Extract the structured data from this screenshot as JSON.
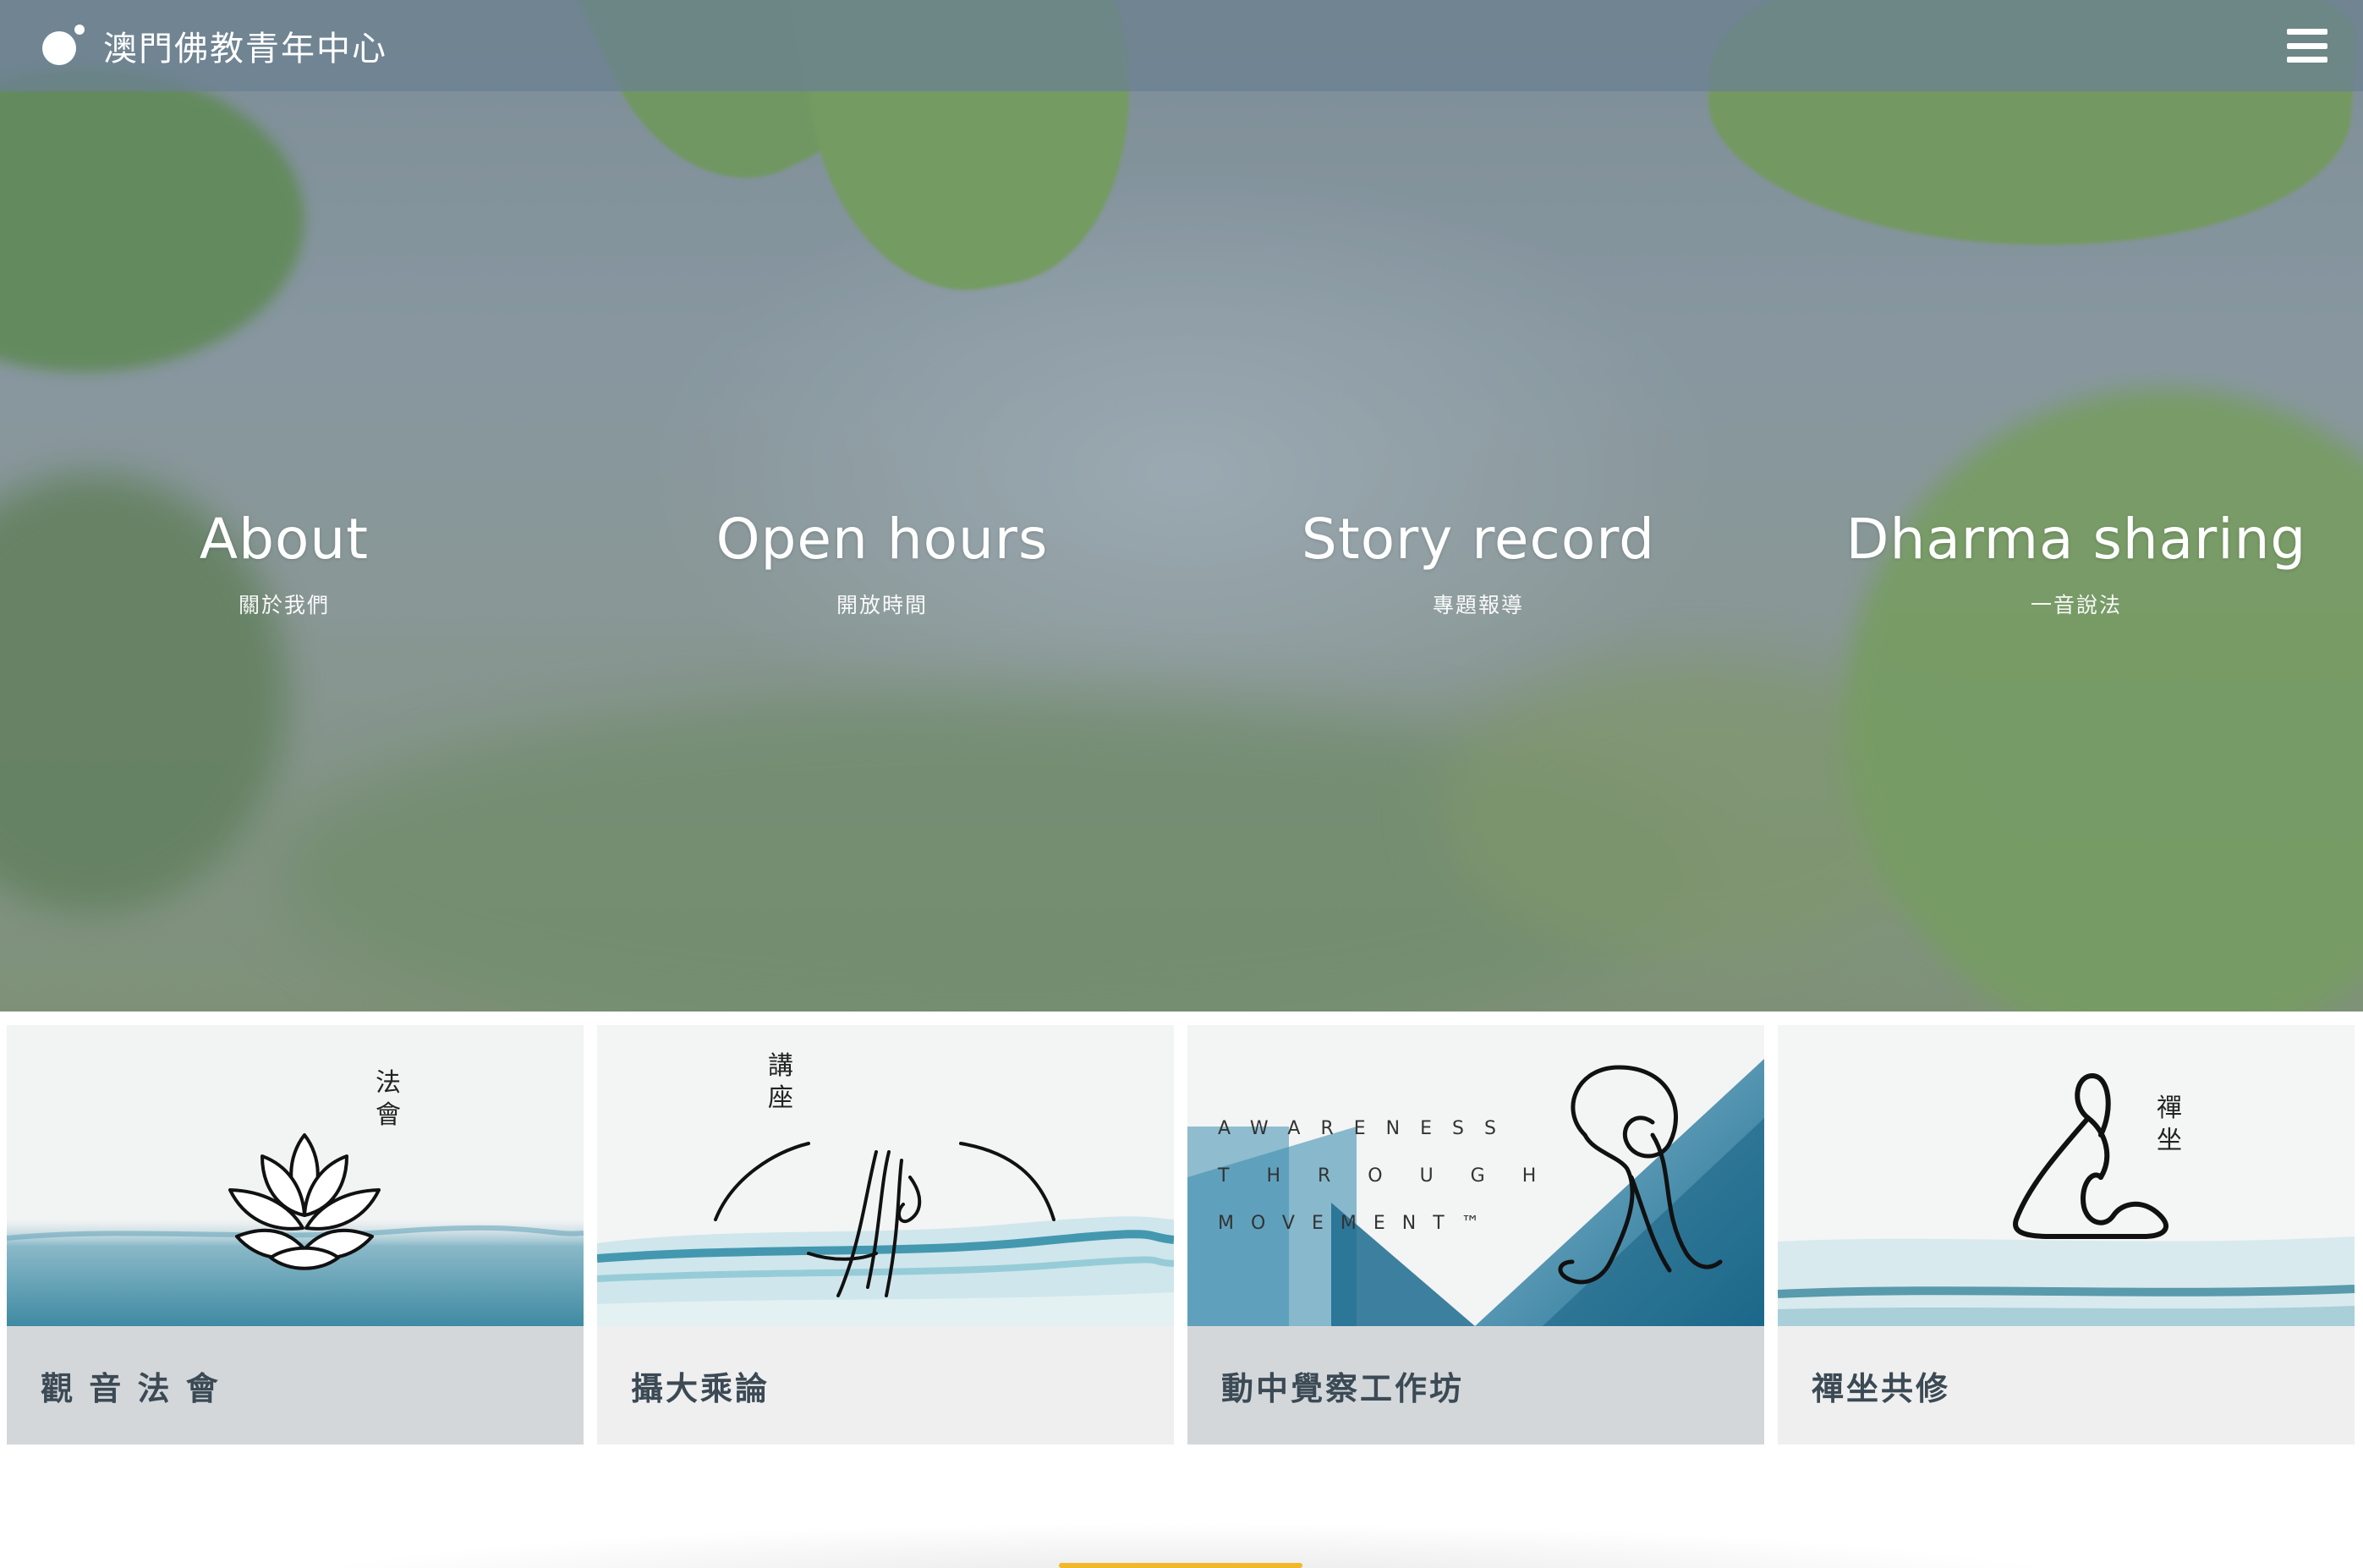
{
  "header": {
    "title": "澳門佛教青年中心",
    "logo_icon": "circle-dot-logo-icon",
    "menu_icon": "hamburger-icon"
  },
  "hero_nav": [
    {
      "en": "About",
      "zh": "關於我們"
    },
    {
      "en": "Open hours",
      "zh": "開放時間"
    },
    {
      "en": "Story record",
      "zh": "專題報導"
    },
    {
      "en": "Dharma sharing",
      "zh": "一音說法"
    }
  ],
  "cards": [
    {
      "label": "觀 音 法 會",
      "art_text": [
        "法",
        "會"
      ],
      "art_icon": "lotus-icon"
    },
    {
      "label": "攝大乘論",
      "art_text": [
        "講",
        "座"
      ],
      "art_icon": "mudra-hand-icon"
    },
    {
      "label": "動中覺察工作坊",
      "art_lines": [
        "AWARENESS",
        "THROUGH",
        "MOVEMENT™"
      ],
      "art_icon": "movement-figure-icon"
    },
    {
      "label": "禪坐共修",
      "art_text": [
        "禪",
        "坐"
      ],
      "art_icon": "meditation-figure-icon"
    }
  ],
  "colors": {
    "header_bg": "#6c8291",
    "card_label_text": "#3b4a55",
    "accent_yellow": "#f1b829"
  }
}
